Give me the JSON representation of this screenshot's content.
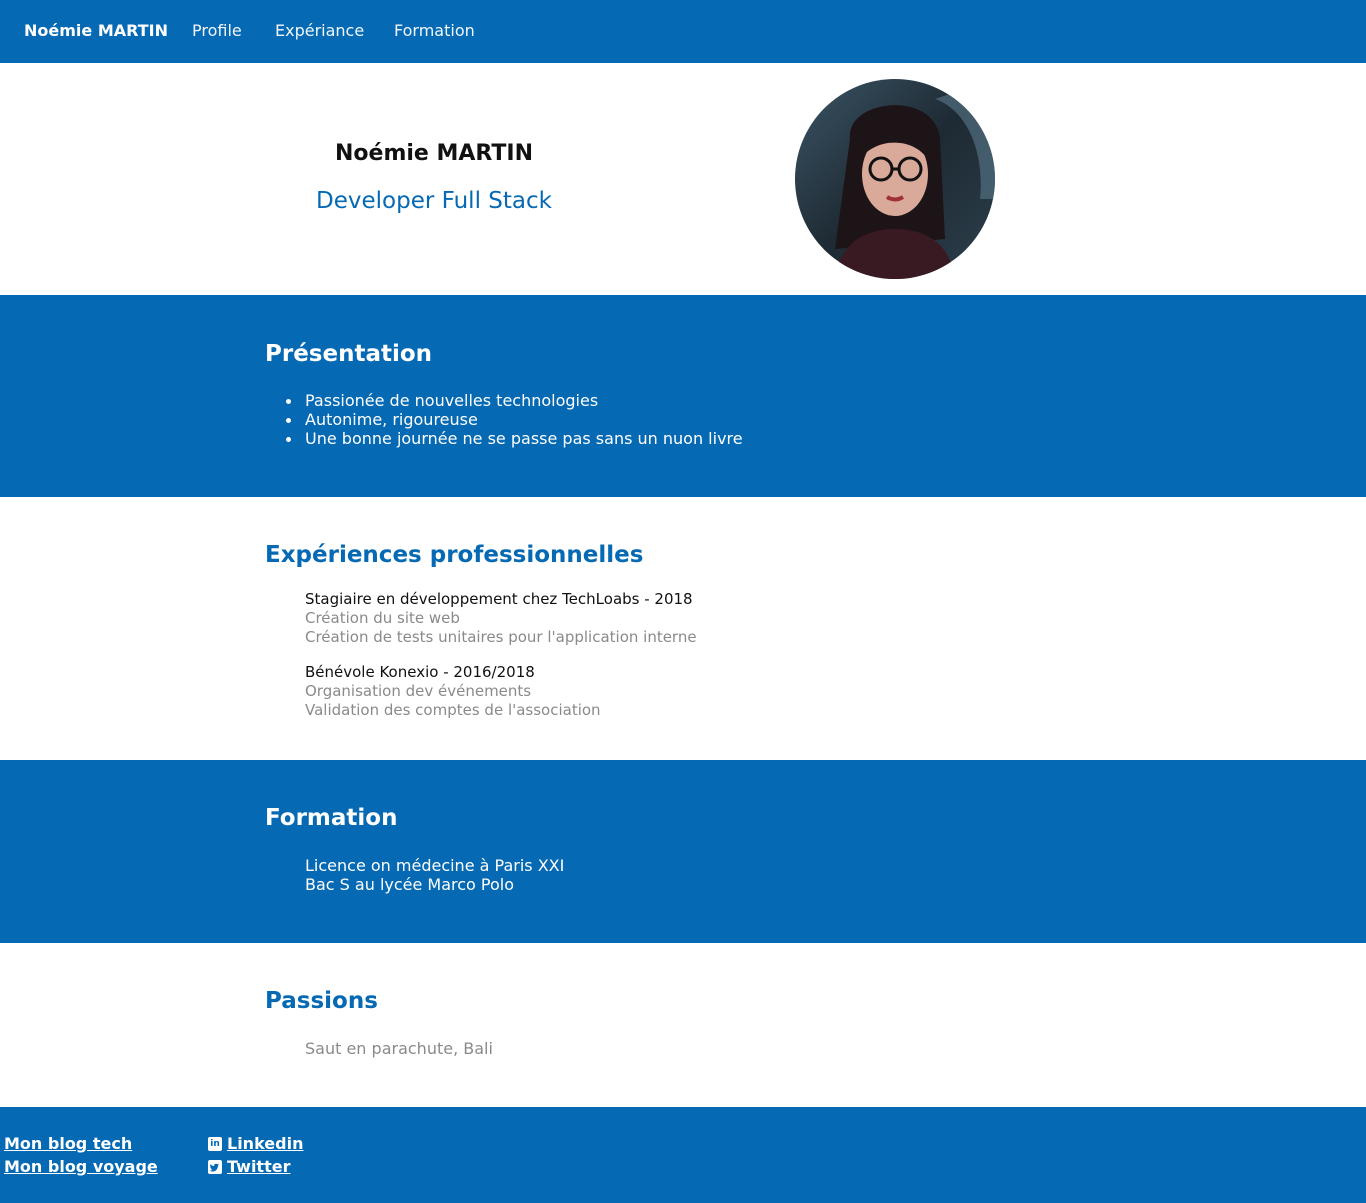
{
  "nav": {
    "brand": "Noémie MARTIN",
    "links": [
      "Profile",
      "Expériance",
      "Formation"
    ],
    "color": "#0569b3"
  },
  "hero": {
    "name": "Noémie MARTIN",
    "title": "Developer Full Stack",
    "avatar_icon": "profile-photo"
  },
  "presentation": {
    "title": "Présentation",
    "items": [
      "Passionée de nouvelles technologies",
      "Autonime, rigoureuse",
      "Une bonne journée ne se passe pas sans un nuon livre"
    ]
  },
  "experience": {
    "title": "Expériences professionnelles",
    "jobs": [
      {
        "heading": "Stagiaire en développement chez TechLoabs - 2018",
        "lines": [
          "Création du site web",
          "Création de tests unitaires pour l'application interne"
        ]
      },
      {
        "heading": "Bénévole Konexio - 2016/2018",
        "lines": [
          "Organisation dev événements",
          "Validation des comptes de l'association"
        ]
      }
    ]
  },
  "formation": {
    "title": "Formation",
    "items": [
      "Licence on médecine à Paris XXI",
      "Bac S au lycée Marco Polo"
    ]
  },
  "passions": {
    "title": "Passions",
    "items": [
      "Saut en parachute, Bali"
    ]
  },
  "footer": {
    "blogs": [
      "Mon blog tech",
      "Mon blog voyage"
    ],
    "social": [
      {
        "label": "Linkedin",
        "icon": "linkedin-icon"
      },
      {
        "label": "Twitter",
        "icon": "twitter-icon"
      }
    ]
  }
}
